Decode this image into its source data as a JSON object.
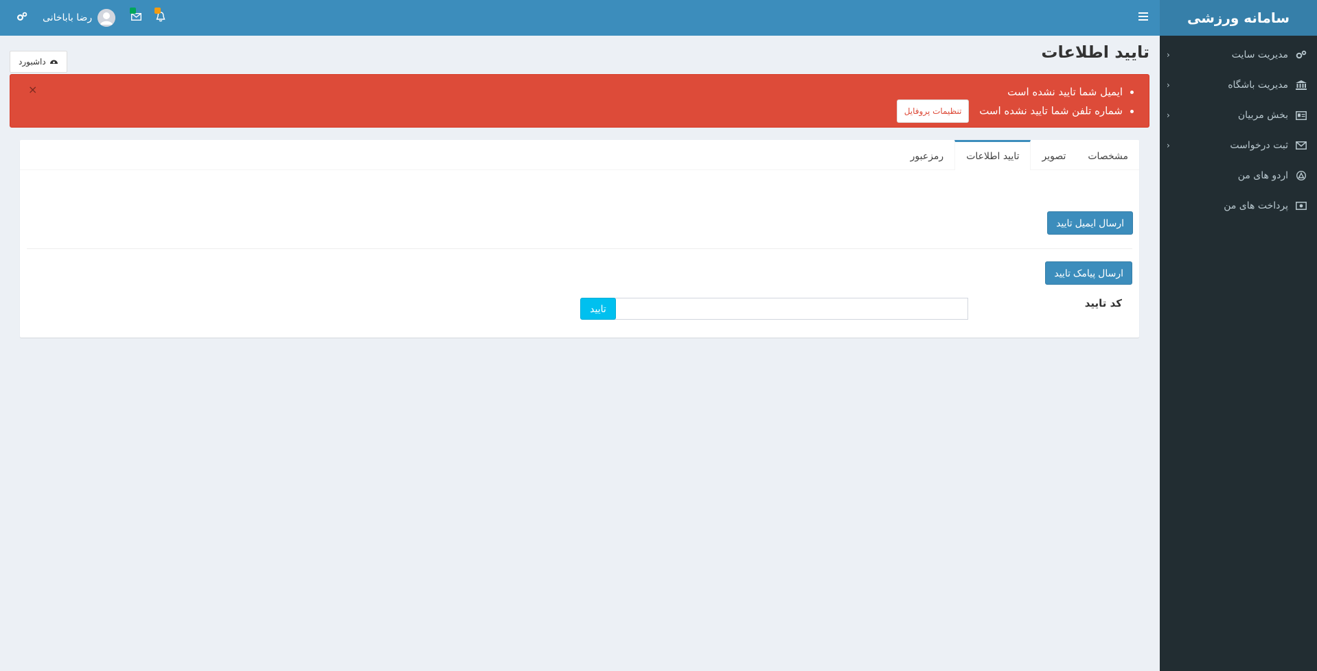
{
  "app": {
    "title": "سامانه ورزشی"
  },
  "sidebar": {
    "items": [
      {
        "label": "مدیریت سایت",
        "icon": "gears-icon",
        "has_submenu": true
      },
      {
        "label": "مدیریت باشگاه",
        "icon": "bank-icon",
        "has_submenu": true
      },
      {
        "label": "بخش مربیان",
        "icon": "id-card-icon",
        "has_submenu": true
      },
      {
        "label": "ثبت درخواست",
        "icon": "envelope-icon",
        "has_submenu": true
      },
      {
        "label": "اردو های من",
        "icon": "tent-icon",
        "has_submenu": false
      },
      {
        "label": "پرداخت های من",
        "icon": "money-icon",
        "has_submenu": false
      }
    ]
  },
  "header": {
    "user_name": "رضا باباخانی",
    "notifications_badge_color": "#f39c12",
    "messages_badge_color": "#00a65a"
  },
  "page": {
    "title": "تایید اطلاعات",
    "breadcrumb": "داشبورد"
  },
  "alert": {
    "messages": [
      "ایمیل شما تایید نشده است",
      "شماره تلفن شما تایید نشده است"
    ],
    "profile_button": "تنظیمات پروفایل",
    "close": "×",
    "color": "#dd4b39"
  },
  "tabs": [
    {
      "label": "مشخصات",
      "active": false
    },
    {
      "label": "تصویر",
      "active": false
    },
    {
      "label": "تایید اطلاعات",
      "active": true
    },
    {
      "label": "رمزعبور",
      "active": false
    }
  ],
  "verify": {
    "email_button": "ارسال ایمیل تایید",
    "sms_button": "ارسال پیامک تایید",
    "code_label": "کد تایید",
    "code_value": "",
    "code_submit": "تایید"
  },
  "colors": {
    "primary": "#3c8dbc",
    "sidebar_bg": "#222d32",
    "info": "#00c0ef"
  }
}
